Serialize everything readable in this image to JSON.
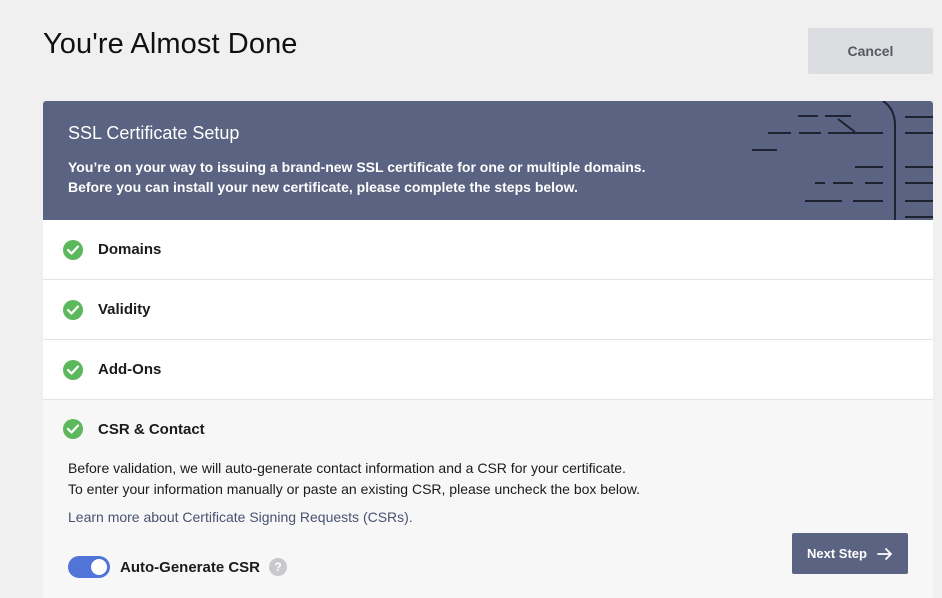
{
  "header": {
    "title": "You're Almost Done",
    "cancel_label": "Cancel"
  },
  "banner": {
    "title": "SSL Certificate Setup",
    "desc_line1": "You’re on your way to issuing a brand-new SSL certificate for one or multiple domains.",
    "desc_line2": "Before you can install your new certificate, please complete the steps below."
  },
  "steps": [
    {
      "label": "Domains",
      "status": "complete"
    },
    {
      "label": "Validity",
      "status": "complete"
    },
    {
      "label": "Add-Ons",
      "status": "complete"
    },
    {
      "label": "CSR & Contact",
      "status": "complete"
    }
  ],
  "csr_section": {
    "body_line1": "Before validation, we will auto-generate contact information and a CSR for your certificate.",
    "body_line2": "To enter your information manually or paste an existing CSR, please uncheck the box below.",
    "link_text": "Learn more about Certificate Signing Requests (CSRs).",
    "toggle_label": "Auto-Generate CSR",
    "toggle_on": true,
    "help_glyph": "?",
    "next_label": "Next Step"
  },
  "colors": {
    "banner": "#5a6381",
    "check": "#5cb85c",
    "toggle": "#5074d8",
    "page_bg": "#f0f0f1"
  }
}
